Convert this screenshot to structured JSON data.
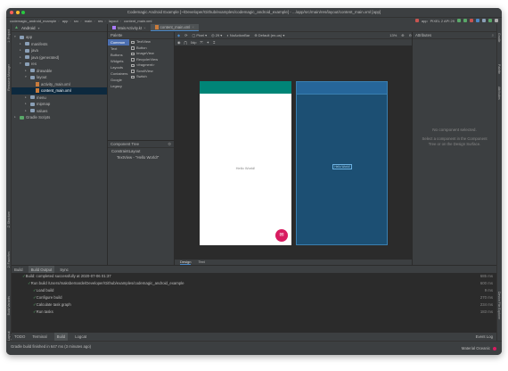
{
  "window": {
    "title": "Codemagic Android Example [~/Developer/Github/examples/codemagic_android_example] - .../app/src/main/res/layout/content_main.xml [app]"
  },
  "breadcrumbs": [
    "codemagic_android_example",
    "app",
    "src",
    "main",
    "res",
    "layout",
    "content_main.xml"
  ],
  "run_config": {
    "module": "app",
    "device": "PIXEL 2 API 29"
  },
  "project": {
    "header": "Android",
    "items": [
      {
        "label": "app",
        "level": 0,
        "type": "folder"
      },
      {
        "label": "manifests",
        "level": 1,
        "type": "folder"
      },
      {
        "label": "java",
        "level": 1,
        "type": "folder"
      },
      {
        "label": "java (generated)",
        "level": 1,
        "type": "folder"
      },
      {
        "label": "res",
        "level": 1,
        "type": "folder"
      },
      {
        "label": "drawable",
        "level": 2,
        "type": "folder"
      },
      {
        "label": "layout",
        "level": 2,
        "type": "folder"
      },
      {
        "label": "activity_main.xml",
        "level": 3,
        "type": "xml"
      },
      {
        "label": "content_main.xml",
        "level": 3,
        "type": "xml",
        "selected": true
      },
      {
        "label": "menu",
        "level": 2,
        "type": "folder"
      },
      {
        "label": "mipmap",
        "level": 2,
        "type": "folder"
      },
      {
        "label": "values",
        "level": 2,
        "type": "folder"
      },
      {
        "label": "Gradle Scripts",
        "level": 0,
        "type": "gradle"
      }
    ]
  },
  "editor_tabs": [
    {
      "label": "MainActivity.kt",
      "active": false
    },
    {
      "label": "content_main.xml",
      "active": true
    }
  ],
  "palette": {
    "header": "Palette",
    "categories": [
      "Common",
      "Text",
      "Buttons",
      "Widgets",
      "Layouts",
      "Containers",
      "Google",
      "Legacy"
    ],
    "items": [
      "TextView",
      "Button",
      "ImageView",
      "RecyclerView",
      "<fragment>",
      "ScrollView",
      "Switch"
    ]
  },
  "component_tree": {
    "header": "Component Tree",
    "items": [
      {
        "label": "ConstraintLayout",
        "level": 0
      },
      {
        "label": "TextView - \"Hello World!\"",
        "level": 1
      }
    ]
  },
  "design_toolbar": {
    "device": "Pixel",
    "api": "29",
    "theme": "NoActionBar",
    "locale": "Default (en-us)",
    "zoom": "13%",
    "margin": "0dp"
  },
  "preview": {
    "hello_text": "Hello World!",
    "blueprint_text": "Hello World!",
    "fab_icon": "✉"
  },
  "design_tabs": [
    "Design",
    "Text"
  ],
  "attributes": {
    "header": "Attributes",
    "empty_title": "No component selected.",
    "empty_hint": "Select a component in the Component Tree or on the Design Surface."
  },
  "build_tabs": {
    "build": "Build",
    "output": "Build Output",
    "sync": "Sync"
  },
  "build_lines": [
    {
      "text": "Build: completed successfully at 2020-07-06 01:37",
      "time": "685 ms",
      "level": 0
    },
    {
      "text": "Run build /Users/maksbernarde/Developer/Github/examples/codemagic_android_example",
      "time": "600 ms",
      "level": 1
    },
    {
      "text": "Load build",
      "time": "9 ms",
      "level": 2
    },
    {
      "text": "Configure build",
      "time": "270 ms",
      "level": 2
    },
    {
      "text": "Calculate task graph",
      "time": "234 ms",
      "level": 2
    },
    {
      "text": "Run tasks",
      "time": "183 ms",
      "level": 2
    }
  ],
  "bottom_tabs": [
    "TODO",
    "Terminal",
    "Build",
    "Logcat"
  ],
  "event_log": "Event Log",
  "status": {
    "message": "Gradle build finished in 647 ms (3 minutes ago)",
    "theme": "Material Oceanic"
  },
  "colors": {
    "accent": "#4a88c7",
    "app_bar": "#008577",
    "fab": "#d81b60"
  }
}
